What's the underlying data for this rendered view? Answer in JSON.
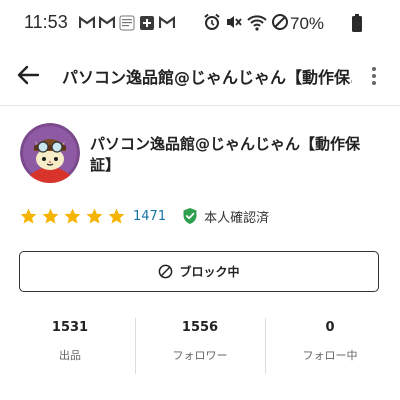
{
  "status_bar": {
    "time": "11:53",
    "battery": "70%",
    "notification_icons": [
      "gmail-icon",
      "gmail-icon",
      "shopping-app-icon",
      "plus-app-icon",
      "gmail-icon"
    ],
    "system_icons": [
      "alarm-icon",
      "mute-icon",
      "wifi-icon",
      "do-not-disturb-icon",
      "battery-icon"
    ]
  },
  "app_bar": {
    "title": "パソコン逸品館@じゃんじゃん【動作保..."
  },
  "profile": {
    "name": "パソコン逸品館@じゃんじゃん【動作保証】",
    "rating": 5,
    "review_count": "1471",
    "verified_label": "本人確認済"
  },
  "block_button": {
    "label": "ブロック中"
  },
  "stats": [
    {
      "value": "1531",
      "label": "出品"
    },
    {
      "value": "1556",
      "label": "フォロワー"
    },
    {
      "value": "0",
      "label": "フォロー中"
    }
  ],
  "colors": {
    "star": "#f5b400",
    "verified": "#2e9e4f",
    "link": "#1a73a6",
    "text": "#222222"
  }
}
